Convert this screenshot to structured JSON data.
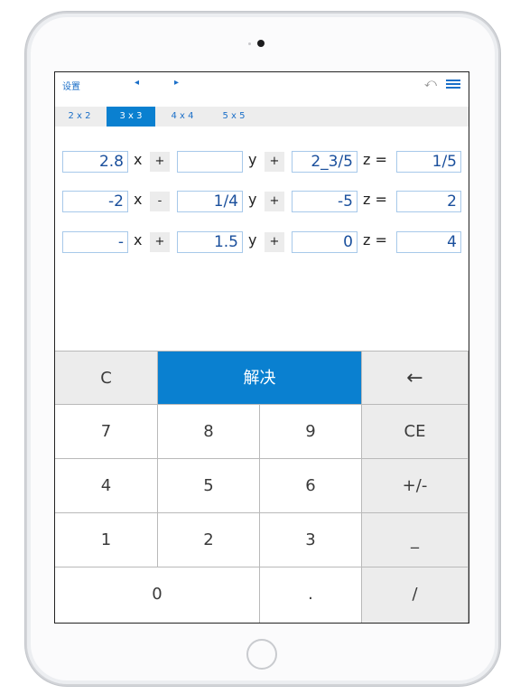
{
  "topbar": {
    "settings": "设置",
    "prev": "◂",
    "next": "▸",
    "undo": "⤺"
  },
  "tabs": [
    "2 x 2",
    "3 x 3",
    "4 x 4",
    "5 x 5"
  ],
  "equations": [
    {
      "a": "2.8",
      "v1": "x",
      "op1": "+",
      "b": "",
      "v2": "y",
      "op2": "+",
      "c": "2_3/5",
      "v3": "z =",
      "r": "1/5"
    },
    {
      "a": "-2",
      "v1": "x",
      "op1": "-",
      "b": "1/4",
      "v2": "y",
      "op2": "+",
      "c": "-5",
      "v3": "z =",
      "r": "2"
    },
    {
      "a": "-",
      "v1": "x",
      "op1": "+",
      "b": "1.5",
      "v2": "y",
      "op2": "+",
      "c": "0",
      "v3": "z =",
      "r": "4"
    }
  ],
  "keypad": {
    "clear": "C",
    "solve": "解决",
    "backspace": "←",
    "k7": "7",
    "k8": "8",
    "k9": "9",
    "ce": "CE",
    "k4": "4",
    "k5": "5",
    "k6": "6",
    "sign": "+/-",
    "k1": "1",
    "k2": "2",
    "k3": "3",
    "underscore": "_",
    "k0": "0",
    "dot": ".",
    "slash": "/"
  },
  "colors": {
    "accent": "#0a80d0",
    "link": "#1b6fc8",
    "keyGray": "#ececec"
  }
}
